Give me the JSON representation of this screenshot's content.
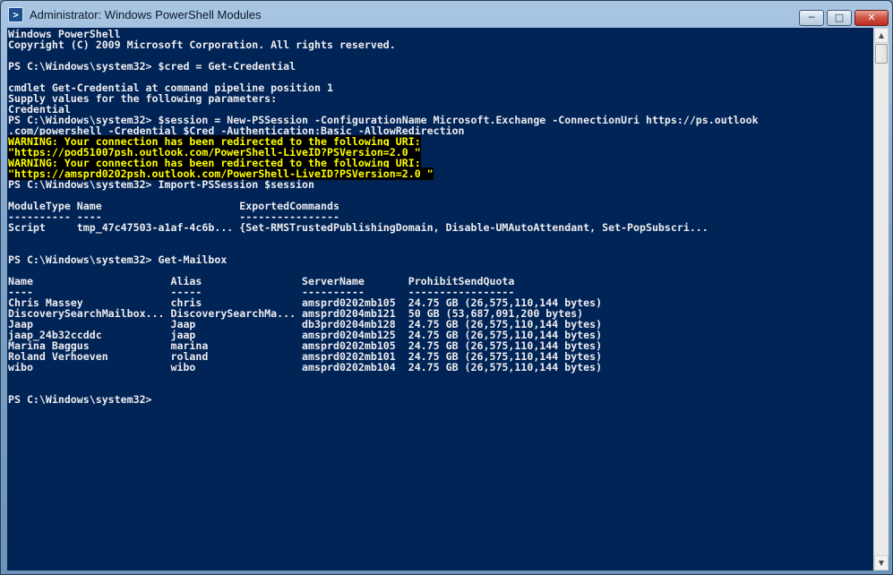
{
  "window": {
    "title": "Administrator: Windows PowerShell Modules",
    "icon": "powershell-icon",
    "controls": {
      "minimize": "minimize-icon",
      "maximize": "maximize-icon",
      "close": "close-icon"
    }
  },
  "console": {
    "background": "#012456",
    "foreground": "#eeedf0",
    "warning_color": "#ffff00",
    "lines": [
      "Windows PowerShell",
      "Copyright (C) 2009 Microsoft Corporation. All rights reserved.",
      "",
      "PS C:\\Windows\\system32> $cred = Get-Credential",
      "",
      "cmdlet Get-Credential at command pipeline position 1",
      "Supply values for the following parameters:",
      "Credential",
      "PS C:\\Windows\\system32> $session = New-PSSession -ConfigurationName Microsoft.Exchange -ConnectionUri https://ps.outlook",
      ".com/powershell -Credential $Cred -Authentication:Basic -AllowRedirection",
      "WARNING: Your connection has been redirected to the following URI:",
      "\"https://pod51007psh.outlook.com/PowerShell-LiveID?PSVersion=2.0 \"",
      "WARNING: Your connection has been redirected to the following URI:",
      "\"https://amsprd0202psh.outlook.com/PowerShell-LiveID?PSVersion=2.0 \"",
      "PS C:\\Windows\\system32> Import-PSSession $session",
      "",
      "ModuleType Name                      ExportedCommands",
      "---------- ----                      ----------------",
      "Script     tmp_47c47503-a1af-4c6b... {Set-RMSTrustedPublishingDomain, Disable-UMAutoAttendant, Set-PopSubscri...",
      "",
      "",
      "PS C:\\Windows\\system32> Get-Mailbox",
      "",
      "Name                      Alias                ServerName       ProhibitSendQuota",
      "----                      -----                ----------       -----------------",
      "Chris Massey              chris                amsprd0202mb105  24.75 GB (26,575,110,144 bytes)",
      "DiscoverySearchMailbox... DiscoverySearchMa... amsprd0204mb121  50 GB (53,687,091,200 bytes)",
      "Jaap                      Jaap                 db3prd0204mb128  24.75 GB (26,575,110,144 bytes)",
      "jaap_24b32ccddc           jaap                 amsprd0204mb125  24.75 GB (26,575,110,144 bytes)",
      "Marina Baggus             marina               amsprd0202mb105  24.75 GB (26,575,110,144 bytes)",
      "Roland Verhoeven          roland               amsprd0202mb101  24.75 GB (26,575,110,144 bytes)",
      "wibo                      wibo                 amsprd0202mb104  24.75 GB (26,575,110,144 bytes)",
      "",
      "",
      "PS C:\\Windows\\system32>"
    ],
    "warning_line_indexes": [
      10,
      11,
      12,
      13
    ]
  },
  "scrollbar": {
    "up_icon": "scroll-up-arrow-icon",
    "down_icon": "scroll-down-arrow-icon"
  }
}
